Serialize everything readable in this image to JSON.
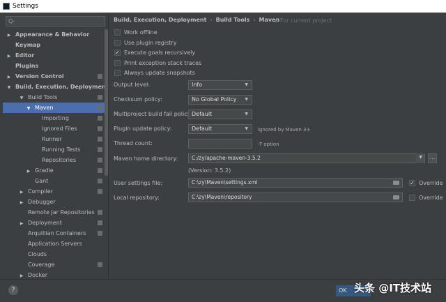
{
  "window": {
    "title": "Settings"
  },
  "sidebar": {
    "search_placeholder": "Q-",
    "items": [
      {
        "label": "Appearance & Behavior",
        "level": 0,
        "arrow": "right",
        "bold": true,
        "proj": false
      },
      {
        "label": "Keymap",
        "level": 0,
        "arrow": "",
        "bold": true,
        "proj": false
      },
      {
        "label": "Editor",
        "level": 0,
        "arrow": "right",
        "bold": true,
        "proj": false
      },
      {
        "label": "Plugins",
        "level": 0,
        "arrow": "",
        "bold": true,
        "proj": false
      },
      {
        "label": "Version Control",
        "level": 0,
        "arrow": "right",
        "bold": true,
        "proj": true
      },
      {
        "label": "Build, Execution, Deployment",
        "level": 0,
        "arrow": "down",
        "bold": true,
        "proj": false
      },
      {
        "label": "Build Tools",
        "level": 1,
        "arrow": "down",
        "bold": false,
        "proj": true
      },
      {
        "label": "Maven",
        "level": 2,
        "arrow": "down",
        "bold": false,
        "proj": true,
        "selected": true
      },
      {
        "label": "Importing",
        "level": 3,
        "arrow": "",
        "bold": false,
        "proj": true
      },
      {
        "label": "Ignored Files",
        "level": 3,
        "arrow": "",
        "bold": false,
        "proj": true
      },
      {
        "label": "Runner",
        "level": 3,
        "arrow": "",
        "bold": false,
        "proj": true
      },
      {
        "label": "Running Tests",
        "level": 3,
        "arrow": "",
        "bold": false,
        "proj": true
      },
      {
        "label": "Repositories",
        "level": 3,
        "arrow": "",
        "bold": false,
        "proj": true
      },
      {
        "label": "Gradle",
        "level": 2,
        "arrow": "right",
        "bold": false,
        "proj": true
      },
      {
        "label": "Gant",
        "level": 2,
        "arrow": "",
        "bold": false,
        "proj": true
      },
      {
        "label": "Compiler",
        "level": 1,
        "arrow": "right",
        "bold": false,
        "proj": true
      },
      {
        "label": "Debugger",
        "level": 1,
        "arrow": "right",
        "bold": false,
        "proj": false
      },
      {
        "label": "Remote Jar Repositories",
        "level": 1,
        "arrow": "",
        "bold": false,
        "proj": true
      },
      {
        "label": "Deployment",
        "level": 1,
        "arrow": "right",
        "bold": false,
        "proj": true
      },
      {
        "label": "Arquillian Containers",
        "level": 1,
        "arrow": "",
        "bold": false,
        "proj": true
      },
      {
        "label": "Application Servers",
        "level": 1,
        "arrow": "",
        "bold": false,
        "proj": false
      },
      {
        "label": "Clouds",
        "level": 1,
        "arrow": "",
        "bold": false,
        "proj": false
      },
      {
        "label": "Coverage",
        "level": 1,
        "arrow": "",
        "bold": false,
        "proj": true
      },
      {
        "label": "Docker",
        "level": 1,
        "arrow": "right",
        "bold": false,
        "proj": false
      }
    ]
  },
  "main": {
    "breadcrumb": [
      "Build, Execution, Deployment",
      "Build Tools",
      "Maven"
    ],
    "for_current_project": "For current project",
    "checkboxes": [
      {
        "label": "Work offline",
        "checked": false
      },
      {
        "label": "Use plugin registry",
        "checked": false
      },
      {
        "label": "Execute goals recursively",
        "checked": true
      },
      {
        "label": "Print exception stack traces",
        "checked": false
      },
      {
        "label": "Always update snapshots",
        "checked": false
      }
    ],
    "output_level": {
      "label": "Output level:",
      "value": "Info"
    },
    "checksum_policy": {
      "label": "Checksum policy:",
      "value": "No Global Policy"
    },
    "fail_policy": {
      "label": "Multiproject build fail policy:",
      "value": "Default"
    },
    "plugin_update": {
      "label": "Plugin update policy:",
      "value": "Default",
      "hint": "ignored by Maven 3+"
    },
    "thread_count": {
      "label": "Thread count:",
      "value": "",
      "hint": "-T option"
    },
    "maven_home": {
      "label": "Maven home directory:",
      "value": "C:/zy/apache-maven-3.5.2",
      "browse": "...",
      "version": "(Version: 3.5.2)"
    },
    "user_settings": {
      "label": "User settings file:",
      "value": "C:\\zy\\Maven\\settings.xml",
      "override_label": "Override",
      "override": true
    },
    "local_repo": {
      "label": "Local repository:",
      "value": "C:\\zy\\Maven\\repository",
      "override_label": "Override",
      "override": false
    }
  },
  "footer": {
    "help": "?",
    "ok": "OK"
  },
  "watermark": "头条 @IT技术站"
}
